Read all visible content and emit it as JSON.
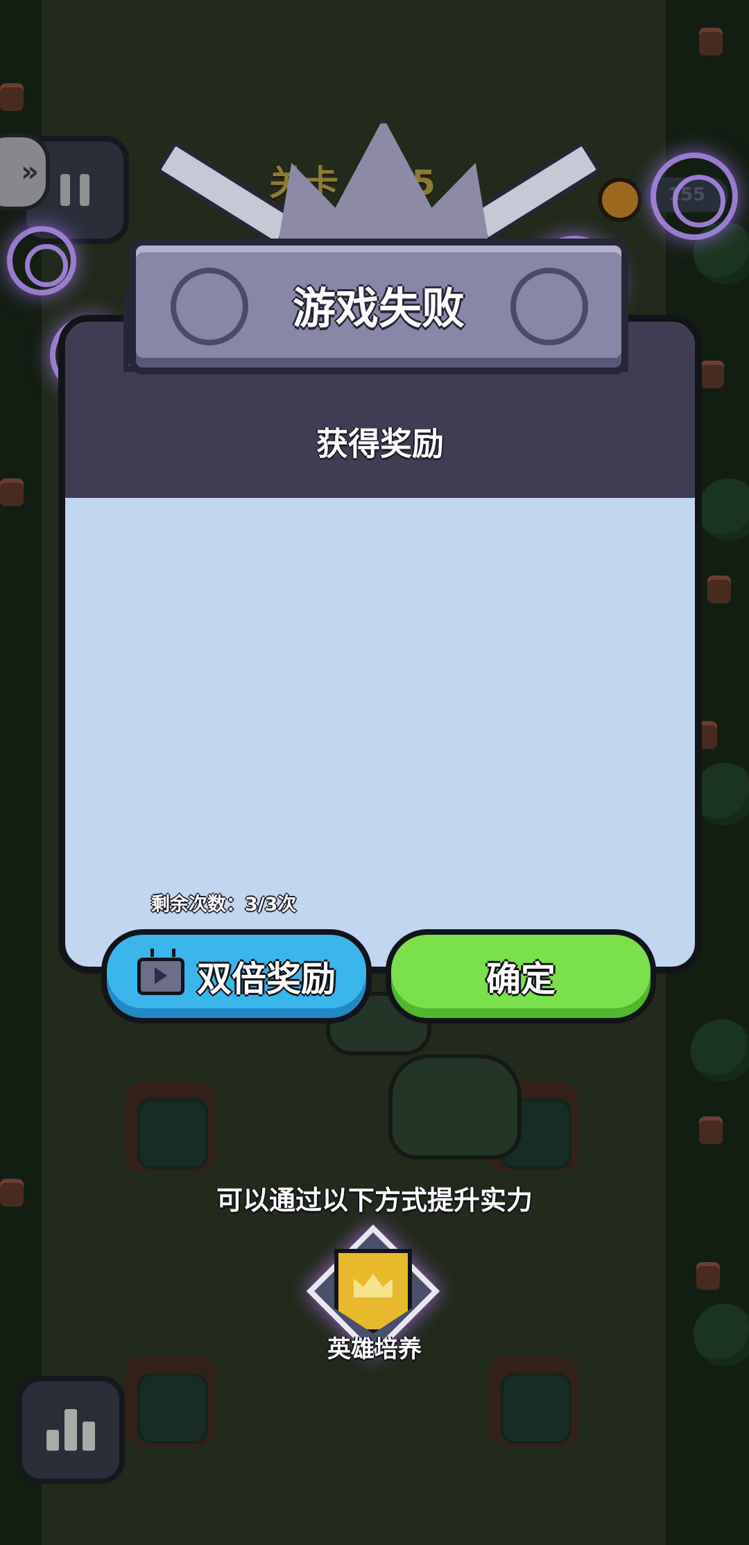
{
  "hud": {
    "level_label": "关卡 0/05",
    "coin_count": "155"
  },
  "dialog": {
    "title": "游戏失败",
    "reward_header": "获得奖励",
    "remaining_attempts": "剩余次数：3/3次",
    "double_button_label": "双倍奖励",
    "confirm_button_label": "确定"
  },
  "below": {
    "hint": "可以通过以下方式提升实力",
    "hero_label": "英雄培养"
  },
  "icons": [
    "pause-icon",
    "stats-icon",
    "expand-icon",
    "tv-ad-icon",
    "hero-banner-icon",
    "coin-icon"
  ]
}
